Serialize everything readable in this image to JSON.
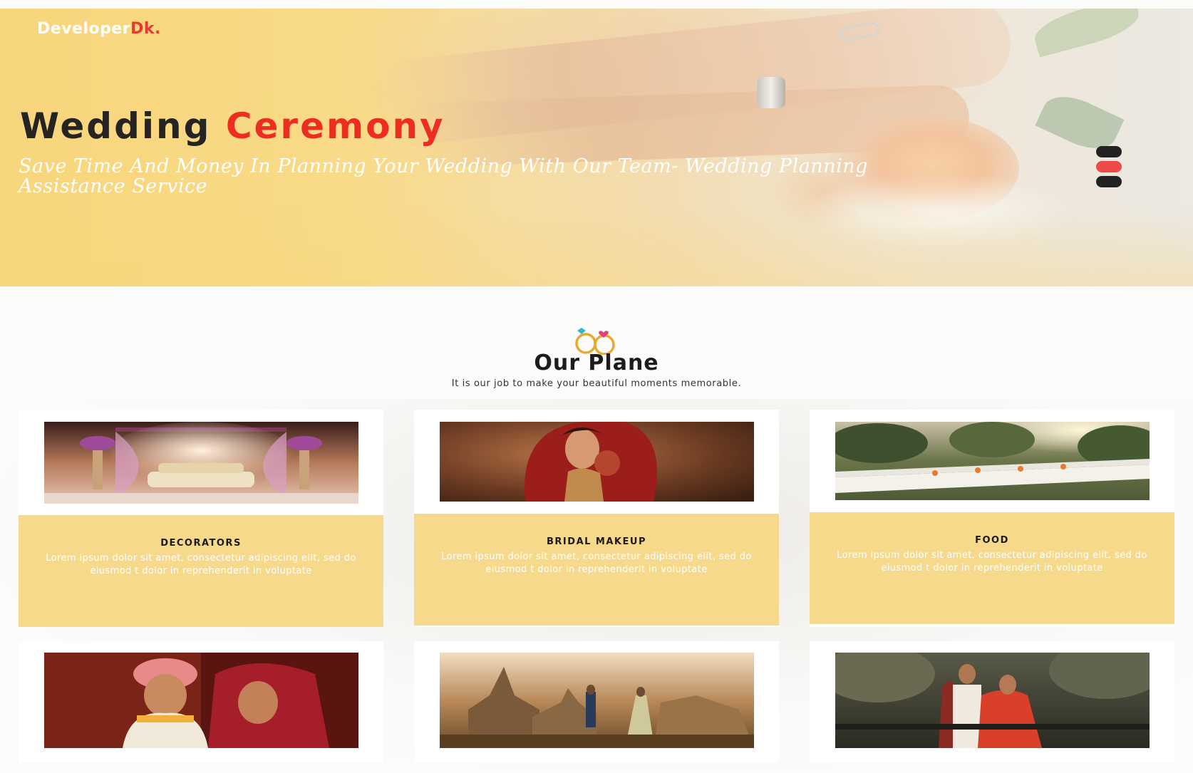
{
  "brand": {
    "name": "Developer",
    "accent": "Dk."
  },
  "hero": {
    "title_main": "Wedding",
    "title_accent": "Ceremony",
    "subtitle": "Save Time And Money In Planning Your Wedding With Our Team- Wedding Planning Assistance Service",
    "slider_dots": 3,
    "active_dot": 2
  },
  "plan": {
    "icon": "wedding-rings-icon",
    "title": "Our Plane",
    "subtitle": "It is our job to make your beautiful moments memorable."
  },
  "services": [
    {
      "title": "DECORATORS",
      "text": "Lorem ipsum dolor sit amet, consectetur adipiscing elit, sed do eiusmod t dolor in reprehenderit in voluptate"
    },
    {
      "title": "BRIDAL MAKEUP",
      "text": "Lorem ipsum dolor sit amet, consectetur adipiscing elit, sed do eiusmod t dolor in reprehenderit in voluptate"
    },
    {
      "title": "FOOD",
      "text": "Lorem ipsum dolor sit amet, consectetur adipiscing elit, sed do eiusmod t dolor in reprehenderit in voluptate"
    }
  ],
  "colors": {
    "accent": "#ec2d1f",
    "card_info": "#f7d98c",
    "hero_gold": "#f7d77f",
    "dot_active": "#ee4a4a",
    "dark": "#262423"
  }
}
